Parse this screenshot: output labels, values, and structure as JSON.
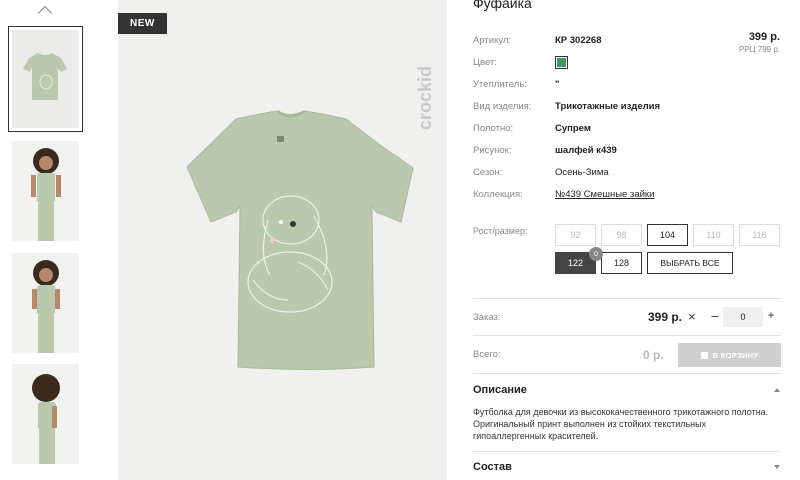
{
  "product": {
    "title": "Фуфайка",
    "badge": "NEW",
    "brand_logo": "crockid",
    "price": "399 р.",
    "rrp": "РРЦ 799 р."
  },
  "attributes": [
    {
      "label": "Артикул:",
      "value": "КР 302268",
      "bold": true
    },
    {
      "label": "Цвет:",
      "value": "",
      "swatch": "#3d9a5a"
    },
    {
      "label": "Утеплитель:",
      "value": "\"",
      "bold": true
    },
    {
      "label": "Вид изделия:",
      "value": "Трикотажные изделия",
      "bold": true
    },
    {
      "label": "Полотно:",
      "value": "Супрем",
      "bold": true
    },
    {
      "label": "Рисунок:",
      "value": "шалфей к439",
      "bold": true
    },
    {
      "label": "Сезон:",
      "value": "Осень-Зима",
      "bold": false
    },
    {
      "label": "Коллекция:",
      "value": "№439 Смешные зайки",
      "link": true
    }
  ],
  "sizes": {
    "label": "Рост/размер:",
    "row1": [
      "92",
      "98",
      "104",
      "110",
      "116"
    ],
    "row2": [
      "122",
      "128"
    ],
    "select_all": "ВЫБРАТЬ ВСЕ",
    "count": "0"
  },
  "order": {
    "label": "Заказ:",
    "price": "399 р.",
    "times": "×",
    "minus": "–",
    "qty": "0",
    "plus": "+"
  },
  "total": {
    "label": "Всего:",
    "value": "0 р.",
    "cart_button": "В КОРЗИНУ"
  },
  "description": {
    "heading": "Описание",
    "text": "Футболка для девочки из высококачественного трикотажного полотна. Оригинальный принт выполнен из стойких текстильных гипоаллергенных красителей."
  },
  "composition": {
    "heading": "Состав"
  },
  "colors": {
    "tshirt": "#b9c9ad",
    "selected_size": "#444444",
    "swatch": "#3d9a5a"
  }
}
